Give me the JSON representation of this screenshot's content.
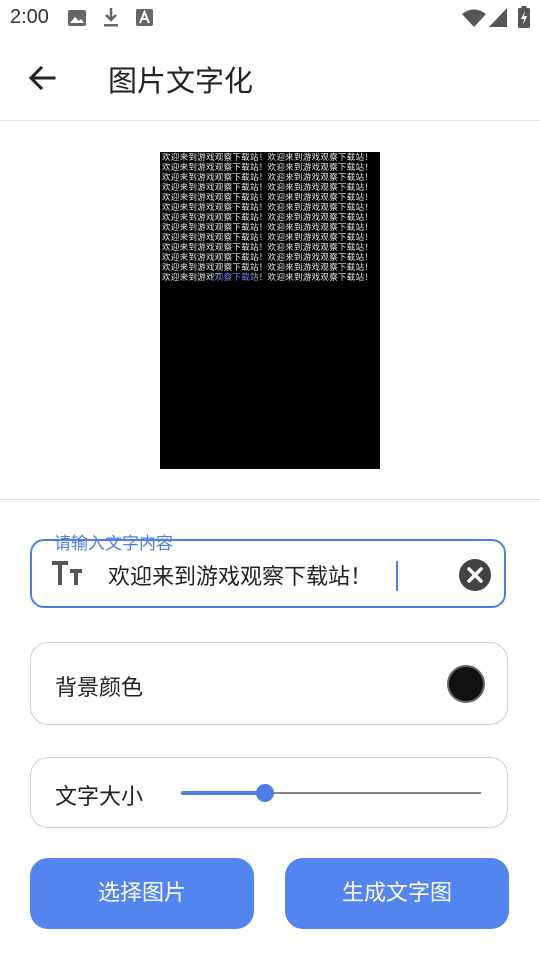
{
  "status_bar": {
    "time": "2:00",
    "icons": [
      "image-icon",
      "download-icon",
      "a-icon",
      "wifi-icon",
      "signal-icon",
      "battery-icon"
    ]
  },
  "app_bar": {
    "title": "图片文字化",
    "back_icon": "back-arrow-icon"
  },
  "preview": {
    "text_pattern": "欢迎来到游戏观察下载站！"
  },
  "text_field": {
    "label": "请输入文字内容",
    "value": "欢迎来到游戏观察下载站！",
    "leading_icon": "text-size-icon",
    "trailing_icon": "clear-icon"
  },
  "background_color": {
    "label": "背景颜色",
    "color": "#111111"
  },
  "text_size": {
    "label": "文字大小",
    "value_fraction": 0.28
  },
  "buttons": {
    "select_image": "选择图片",
    "generate": "生成文字图"
  },
  "colors": {
    "accent": "#4f7fe6",
    "button": "#5285ef"
  }
}
